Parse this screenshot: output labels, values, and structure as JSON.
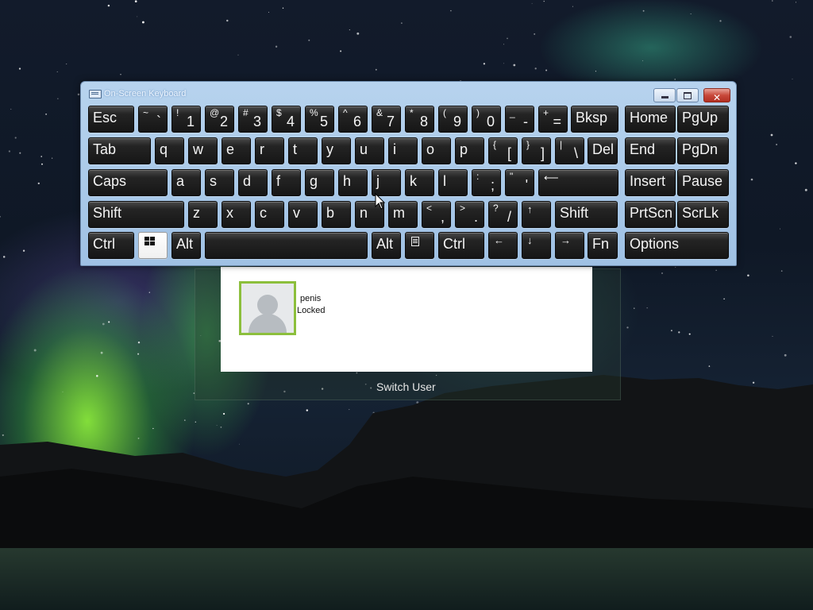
{
  "keyboard_window": {
    "title": "On-Screen Keyboard",
    "close_glyph": "✕"
  },
  "rows": [
    [
      {
        "id": "esc",
        "label": "Esc"
      },
      {
        "id": "tilde",
        "top": "~",
        "bottom": "`"
      },
      {
        "id": "1",
        "top": "!",
        "bottom": "1"
      },
      {
        "id": "2",
        "top": "@",
        "bottom": "2"
      },
      {
        "id": "3",
        "top": "#",
        "bottom": "3"
      },
      {
        "id": "4",
        "top": "$",
        "bottom": "4"
      },
      {
        "id": "5",
        "top": "%",
        "bottom": "5"
      },
      {
        "id": "6",
        "top": "^",
        "bottom": "6"
      },
      {
        "id": "7",
        "top": "&",
        "bottom": "7"
      },
      {
        "id": "8",
        "top": "*",
        "bottom": "8"
      },
      {
        "id": "9",
        "top": "(",
        "bottom": "9"
      },
      {
        "id": "0",
        "top": ")",
        "bottom": "0"
      },
      {
        "id": "minus",
        "top": "_",
        "bottom": "-"
      },
      {
        "id": "equals",
        "top": "+",
        "bottom": "="
      },
      {
        "id": "bksp",
        "label": "Bksp"
      },
      {
        "id": "home",
        "label": "Home"
      },
      {
        "id": "pgup",
        "label": "PgUp"
      }
    ],
    [
      {
        "id": "tab",
        "label": "Tab"
      },
      {
        "id": "q",
        "label": "q"
      },
      {
        "id": "w",
        "label": "w"
      },
      {
        "id": "e",
        "label": "e"
      },
      {
        "id": "r",
        "label": "r"
      },
      {
        "id": "t",
        "label": "t"
      },
      {
        "id": "y",
        "label": "y"
      },
      {
        "id": "u",
        "label": "u"
      },
      {
        "id": "i",
        "label": "i"
      },
      {
        "id": "o",
        "label": "o"
      },
      {
        "id": "p",
        "label": "p"
      },
      {
        "id": "lbracket",
        "top": "{",
        "bottom": "["
      },
      {
        "id": "rbracket",
        "top": "}",
        "bottom": "]"
      },
      {
        "id": "backslash",
        "top": "|",
        "bottom": "\\"
      },
      {
        "id": "del",
        "label": "Del"
      },
      {
        "id": "end",
        "label": "End"
      },
      {
        "id": "pgdn",
        "label": "PgDn"
      }
    ],
    [
      {
        "id": "caps",
        "label": "Caps"
      },
      {
        "id": "a",
        "label": "a"
      },
      {
        "id": "s",
        "label": "s"
      },
      {
        "id": "d",
        "label": "d"
      },
      {
        "id": "f",
        "label": "f"
      },
      {
        "id": "g",
        "label": "g"
      },
      {
        "id": "h",
        "label": "h"
      },
      {
        "id": "j",
        "label": "j"
      },
      {
        "id": "k",
        "label": "k"
      },
      {
        "id": "l",
        "label": "l"
      },
      {
        "id": "semicolon",
        "top": ":",
        "bottom": ";"
      },
      {
        "id": "quote",
        "top": "\"",
        "bottom": "'"
      },
      {
        "id": "enter",
        "arrow": "⟵"
      },
      {
        "id": "insert",
        "label": "Insert"
      },
      {
        "id": "pause",
        "label": "Pause"
      }
    ],
    [
      {
        "id": "lshift",
        "label": "Shift"
      },
      {
        "id": "z",
        "label": "z"
      },
      {
        "id": "x",
        "label": "x"
      },
      {
        "id": "c",
        "label": "c"
      },
      {
        "id": "v",
        "label": "v"
      },
      {
        "id": "b",
        "label": "b"
      },
      {
        "id": "n",
        "label": "n"
      },
      {
        "id": "m",
        "label": "m"
      },
      {
        "id": "comma",
        "top": "<",
        "bottom": ","
      },
      {
        "id": "period",
        "top": ">",
        "bottom": "."
      },
      {
        "id": "slash",
        "top": "?",
        "bottom": "/"
      },
      {
        "id": "up",
        "arrow": "↑"
      },
      {
        "id": "rshift",
        "label": "Shift"
      },
      {
        "id": "prtscn",
        "label": "PrtScn"
      },
      {
        "id": "scrlk",
        "label": "ScrLk"
      }
    ],
    [
      {
        "id": "lctrl",
        "label": "Ctrl"
      },
      {
        "id": "win",
        "icon": "windows-logo-icon"
      },
      {
        "id": "lalt",
        "label": "Alt"
      },
      {
        "id": "space",
        "label": ""
      },
      {
        "id": "ralt",
        "label": "Alt"
      },
      {
        "id": "menu",
        "icon": "context-menu-icon"
      },
      {
        "id": "rctrl",
        "label": "Ctrl"
      },
      {
        "id": "left",
        "arrow": "←"
      },
      {
        "id": "down",
        "arrow": "↓"
      },
      {
        "id": "right",
        "arrow": "→"
      },
      {
        "id": "fn",
        "label": "Fn"
      },
      {
        "id": "options",
        "label": "Options"
      }
    ]
  ],
  "login": {
    "user_name": "penis",
    "user_status": "Locked",
    "switch_user_label": "Switch User"
  },
  "colors": {
    "avatar_border": "#8cbf3c",
    "key_face": "#161616",
    "window_frame": "#a9c8e8"
  }
}
